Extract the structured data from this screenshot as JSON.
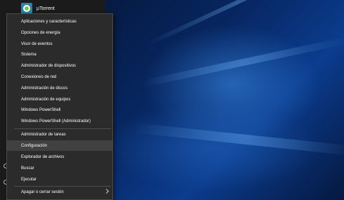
{
  "pinned_app": {
    "name": "µTorrent"
  },
  "menu": {
    "group1": [
      "Aplicaciones y características",
      "Opciones de energía",
      "Visor de eventos",
      "Sistema",
      "Administrador de dispositivos",
      "Conexiones de red",
      "Administración de discos",
      "Administración de equipos",
      "Windows PowerShell",
      "Windows PowerShell (Administrador)"
    ],
    "group2": [
      "Administrador de tareas",
      "Configuración",
      "Explorador de archivos",
      "Buscar",
      "Ejecutar"
    ],
    "group3": [
      "Apagar o cerrar sesión"
    ],
    "highlighted": "Configuración"
  },
  "colors": {
    "menu_background": "#2b2b2b",
    "menu_highlight": "#414141",
    "desktop_accent": "#0b3c8e"
  },
  "icons": {
    "app": "utorrent-icon",
    "submenu": "chevron-right-icon"
  }
}
